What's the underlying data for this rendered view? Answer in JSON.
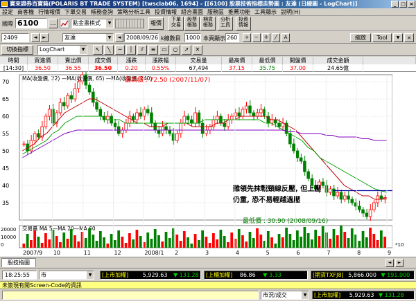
{
  "window": {
    "title": "寶來證券百寶箱(POLARIS BT TRADE SYSTEM)  [twsclab06, 1694] - [[6100] 股票技術指標走勢圖 : 友達 (日線圖 - LogChart)]"
  },
  "menu": [
    "設定",
    "商客機",
    "行情報價",
    "下單交易",
    "帳務查詢",
    "策略分析工具",
    "投資情報",
    "組合畫面",
    "服務區",
    "推薦功能",
    "工具顯示",
    "說明(H)"
  ],
  "toolbar1": {
    "market_label": "國際",
    "symbol_value": "6100",
    "dropdown_value": "點金畫棋式",
    "btn_report": "報價",
    "btn_trade": "下單\n交易",
    "btn_stock_account": "股票\n帳務",
    "btn_futures_account": "期貨\n帳務",
    "btn_analysis": "分析\n工具",
    "btn_info": "投資\n情報"
  },
  "toolbar2": {
    "code_value": "2409",
    "name_value": "友達",
    "date_value": "2008/09/26",
    "kline_label": "k線數目",
    "kline_value": "1000",
    "show_label": "本頁顯示",
    "show_value": "260",
    "right_btn_1": "縮放",
    "right_btn_2": "Tool",
    "right_btn_3": "▼"
  },
  "toolbar3": {
    "select_indicator": "切換指標",
    "chart_type": "LogChart"
  },
  "quote": {
    "headers": [
      "時間",
      "買進價",
      "賣出價",
      "成交價",
      "漲跌",
      "漲跌幅",
      "交易量",
      "最高價",
      "最低價",
      "開盤價",
      "成交金額"
    ],
    "values": [
      "[14:30]",
      "36.50",
      "36.55",
      "36.50",
      "0.20",
      "0.55%",
      "67,494",
      "37.15",
      "35.75",
      "37.00",
      "24.65億"
    ],
    "colors": [
      "#000000",
      "#ff0000",
      "#ff0000",
      "#ff0000",
      "#ff0000",
      "#ff0000",
      "#000000",
      "#ff0000",
      "#008000",
      "#ff0000",
      "#000000"
    ]
  },
  "chart": {
    "legend_price": "MA(收盤價, 22) —MA(收盤價, 65) —MA(收盤價, 240)",
    "high_label": "最高價 : 72.50 (2007/11/07)",
    "low_label": "最低價 : 30.90 (2008/09/16)",
    "annotation_line1": "難領先抹戰頸線反壓, 但上壓",
    "annotation_line2": "仍重, 恐不易輕越過壓",
    "legend_volume": "交易量 MA 5—MA 20—MA 60",
    "vol_unit": "*10",
    "y_ticks": [
      "70",
      "65",
      "60",
      "55",
      "50",
      "45",
      "40",
      "35"
    ],
    "vol_ticks": [
      "20000",
      "10000",
      "0"
    ],
    "x_labels": [
      "2007/9",
      "10",
      "11",
      "12",
      "2008/1",
      "2",
      "3",
      "4",
      "5",
      "6",
      "7",
      "8",
      "9"
    ],
    "colors": {
      "up": "#ff0000",
      "down": "#008000",
      "ma22": "#c00000",
      "ma65": "#00a000",
      "ma240": "#8000c0",
      "neckline": "#0000a0"
    }
  },
  "chart_data": {
    "type": "candlestick",
    "title": "友達 (日線圖 - LogChart)",
    "xlabel": "",
    "ylabel": "",
    "x": [
      "2007/9",
      "10",
      "11",
      "12",
      "2008/1",
      "2",
      "3",
      "4",
      "5",
      "6",
      "7",
      "8",
      "9"
    ],
    "ylim": [
      30,
      72
    ],
    "close_series": [
      52,
      50,
      53,
      55,
      54,
      57,
      60,
      62,
      58,
      61,
      64,
      63,
      66,
      65,
      68,
      70,
      72,
      69,
      67,
      64,
      62,
      60,
      59,
      60,
      58,
      57,
      55,
      56,
      58,
      60,
      59,
      61,
      60,
      62,
      61,
      58,
      56,
      55,
      57,
      56,
      55,
      53,
      55,
      58,
      60,
      59,
      58,
      61,
      58,
      55,
      56,
      57,
      59,
      60,
      58,
      57,
      59,
      60,
      61,
      60,
      62,
      63,
      61,
      60,
      61,
      62,
      60,
      58,
      59,
      58,
      57,
      58,
      55,
      52,
      50,
      48,
      47,
      44,
      42,
      40,
      39,
      41,
      40,
      38,
      39,
      37,
      38,
      36,
      37,
      36,
      35,
      34,
      33,
      32,
      31,
      33,
      35,
      37,
      36,
      36.5
    ],
    "ma_series": [
      {
        "name": "MA(收盤價, 22)",
        "values": [
          50,
          51,
          52,
          54,
          55,
          57,
          59,
          61,
          62,
          63,
          64,
          65,
          65,
          64,
          63,
          62,
          61,
          60,
          59,
          58,
          58,
          57,
          57,
          57,
          58,
          58,
          58,
          58,
          57,
          57,
          57,
          57,
          58,
          58,
          59,
          59,
          60,
          60,
          60,
          60,
          60,
          59,
          59,
          58,
          57,
          56,
          54,
          52,
          50,
          48,
          46,
          44,
          42,
          40,
          39,
          38,
          37,
          37,
          36,
          36,
          36.5
        ]
      },
      {
        "name": "MA(收盤價, 65)",
        "values": [
          49,
          50,
          51,
          52,
          53,
          55,
          56,
          58,
          59,
          60,
          60,
          60,
          60,
          60,
          59,
          59,
          59,
          58,
          58,
          58,
          58,
          58,
          58,
          58,
          58,
          58,
          58,
          58,
          58,
          58,
          59,
          59,
          59,
          59,
          59,
          59,
          59,
          59,
          59,
          59,
          58,
          58,
          57,
          56,
          55,
          54,
          53,
          51,
          50,
          48,
          47,
          46,
          45,
          44,
          43,
          42,
          41,
          40,
          39,
          38.5,
          38
        ]
      },
      {
        "name": "MA(收盤價, 240)",
        "values": [
          48,
          49,
          50,
          51,
          52,
          53,
          54,
          55,
          55.5,
          56,
          56,
          56,
          56,
          56,
          56,
          56,
          56,
          56,
          56,
          56,
          56,
          56,
          56,
          56,
          56,
          56,
          56,
          56,
          56,
          56,
          56,
          56,
          56,
          56,
          56,
          56,
          56,
          56,
          56,
          56,
          56,
          56,
          56,
          56,
          55.5,
          55.5,
          55,
          55,
          55,
          55,
          54.5,
          54.5,
          54,
          54,
          54,
          54,
          53.5,
          53.5,
          53,
          53,
          53
        ]
      }
    ],
    "high": {
      "value": 72.5,
      "date": "2007/11/07"
    },
    "low": {
      "value": 30.9,
      "date": "2008/09/16"
    },
    "neckline": 38.5
  },
  "tabs": {
    "tab1": "股技指圖"
  },
  "status": {
    "time": "18:25:55",
    "market_label": "市",
    "t1_label": "[上市加權]",
    "t1_value": "5,929.63",
    "t1_change": "▼ 131.28",
    "t2_label": "[上櫃加權]",
    "t2_value": "86.86",
    "t2_change": "▼ 3.33",
    "t3_label": "[期貨TXFJ8]",
    "t3_value": "5,866.000",
    "t3_change": "▼ 191.000",
    "message": "未簽現有開Screen-Code的資訊",
    "bottom_label": "市況/成交",
    "b2_label": "[上市加權]",
    "b2_value": "5,929.63",
    "b2_change": "▼ 131.28"
  }
}
